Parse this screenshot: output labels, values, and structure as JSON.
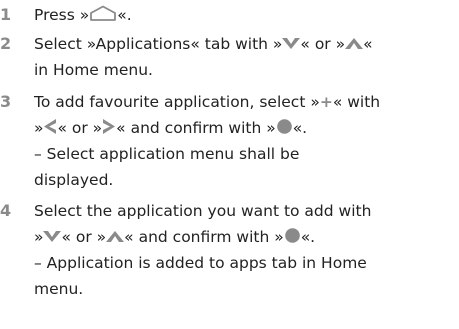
{
  "steps": [
    {
      "number": "1",
      "line1": {
        "before": "Press »",
        "after": "«."
      }
    },
    {
      "number": "2",
      "line1": {
        "before": "Select »Applications« tab with »",
        "mid": "« or »",
        "after": "«"
      },
      "line2": "in Home menu."
    },
    {
      "number": "3",
      "line1": {
        "before": "To add favourite application, select »",
        "symbol": "+",
        "after": "« with"
      },
      "line2": {
        "before": "»",
        "mid": "« or »",
        "mid2": "« and confirm with »",
        "after": "«."
      },
      "line3": "– Select application menu shall be",
      "line4": "displayed."
    },
    {
      "number": "4",
      "line1": "Select the application you want to add with",
      "line2": {
        "before": "»",
        "mid": "« or »",
        "mid2": "« and confirm with »",
        "after": "«."
      },
      "line3": "– Application is added to apps tab in Home",
      "line4": "menu."
    }
  ],
  "icons": {
    "home": "home-icon",
    "down": "chevron-down-icon",
    "up": "chevron-up-icon",
    "left": "chevron-left-icon",
    "right": "chevron-right-icon",
    "ok": "ok-button-icon"
  },
  "colors": {
    "text": "#222222",
    "step_number": "#8a8a8a",
    "icon": "#8a8a8a"
  }
}
